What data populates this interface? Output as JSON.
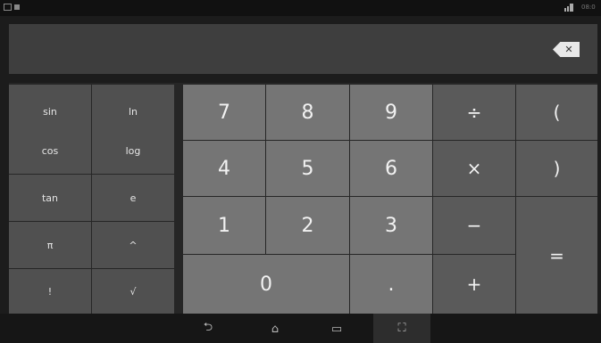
{
  "display": {
    "backspace_label": "✕"
  },
  "status": {
    "time": "08:0"
  },
  "keys": {
    "sin": "sin",
    "ln": "ln",
    "cos": "cos",
    "log": "log",
    "tan": "tan",
    "e": "e",
    "pi": "π",
    "pow": "^",
    "fact": "!",
    "sqrt": "√",
    "d7": "7",
    "d8": "8",
    "d9": "9",
    "d4": "4",
    "d5": "5",
    "d6": "6",
    "d1": "1",
    "d2": "2",
    "d3": "3",
    "d0": "0",
    "dot": ".",
    "div": "÷",
    "mul": "×",
    "sub": "−",
    "add": "+",
    "lparen": "(",
    "rparen": ")",
    "eq": "="
  },
  "navbar": {
    "back": "⮌",
    "home": "⌂",
    "recents": "▭",
    "screenshot": "⛶"
  },
  "colors": {
    "display_bg": "#3e3e3e",
    "adv_key_bg": "#505050",
    "num_key_bg": "#757575",
    "op_key_bg": "#5a5a5a"
  }
}
